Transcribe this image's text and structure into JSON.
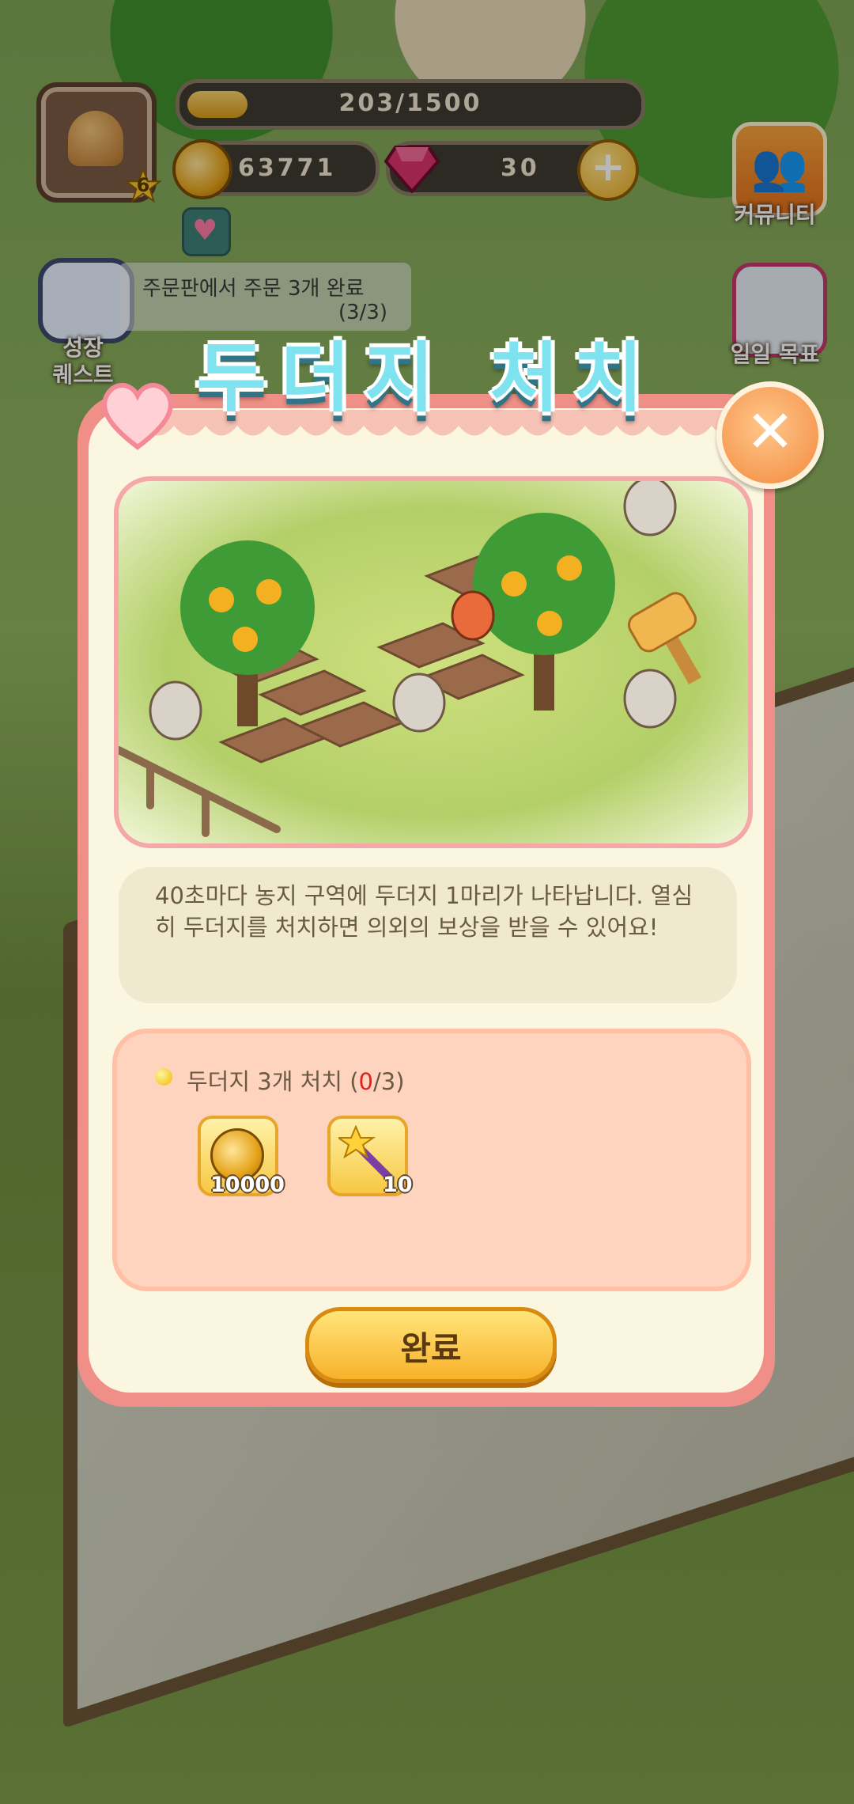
{
  "hud": {
    "level": "6",
    "xp_text": "203/1500",
    "xp_progress": 0.135,
    "coins": "63771",
    "gems": "30"
  },
  "side": {
    "community_label": "커뮤니티",
    "daily_goal_label": "일일 목표",
    "growth_quest_label_1": "성장",
    "growth_quest_label_2": "퀘스트"
  },
  "quest_banner": {
    "text": "주문판에서 주문 3개 완료",
    "progress": "(3/3)"
  },
  "dialog": {
    "title": "두더지 처치",
    "description": "40초마다 농지 구역에 두더지 1마리가 나타납니다. 열심히 두더지를 처치하면 의외의 보상을 받을 수 있어요!",
    "mission_label": "두더지 3개 처치",
    "mission_progress_open": "(",
    "mission_progress_current": "0",
    "mission_progress_total": "/3)",
    "rewards": [
      {
        "icon": "coin-icon",
        "qty": "10000"
      },
      {
        "icon": "magic-wand-icon",
        "qty": "10"
      }
    ],
    "complete_button": "완료"
  }
}
